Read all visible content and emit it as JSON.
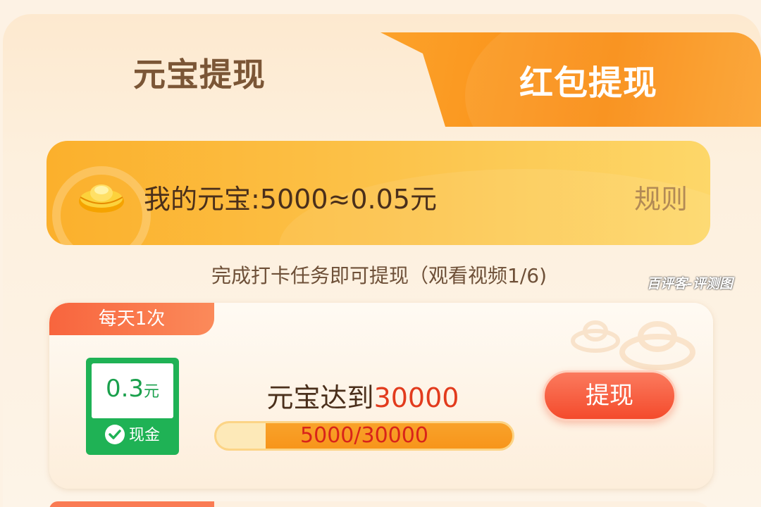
{
  "tabs": {
    "active_label": "元宝提现",
    "inactive_label": "红包提现"
  },
  "banner": {
    "balance_text": "我的元宝:5000≈0.05元",
    "rules_label": "规则"
  },
  "task_hint": "完成打卡任务即可提现（观看视频1/6)",
  "watermark": "百评客-评测图",
  "item": {
    "frequency_badge": "每天1次",
    "amount_value": "0.3",
    "amount_unit": "元",
    "cash_label": "现金",
    "goal_prefix": "元宝达到",
    "goal_value": "30000",
    "progress_text": "5000/30000",
    "progress_fraction": 0.1667,
    "withdraw_label": "提现"
  },
  "colors": {
    "accent_orange": "#f98c12",
    "cash_green": "#1fb255",
    "button_red": "#f44b2c",
    "highlight_red": "#e23b1d"
  },
  "icons": {
    "ingot": "gold-ingot-icon",
    "check": "check-circle-icon"
  }
}
